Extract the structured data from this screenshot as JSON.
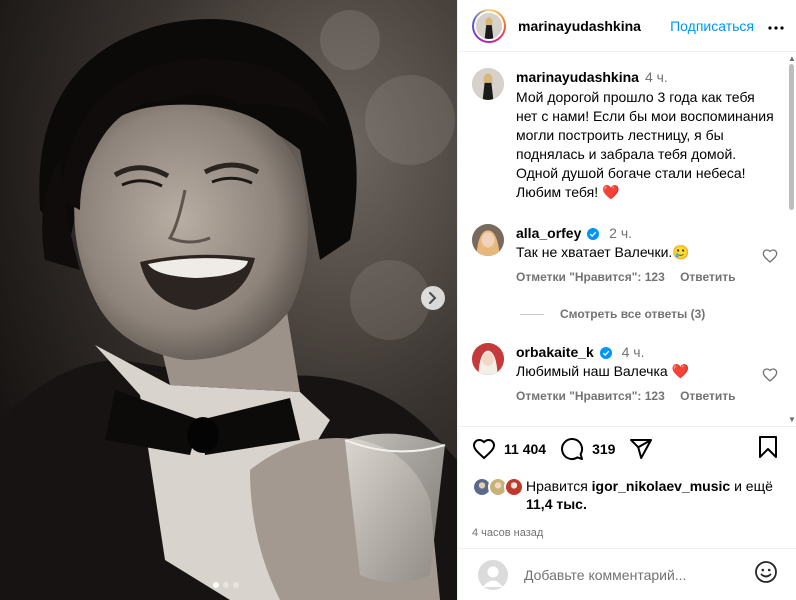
{
  "post": {
    "username": "marinayudashkina",
    "follow_label": "Подписаться",
    "more_icon": "more-horizontal-icon"
  },
  "caption": {
    "username": "marinayudashkina",
    "time": "4 ч.",
    "text": "Мой дорогой прошло 3 года как тебя нет с нами! Если бы мои воспоминания могли построить лестницу, я бы поднялась и забрала тебя домой. Одной душой богаче стали небеса! Любим тебя!",
    "emoji": "❤️"
  },
  "comments": [
    {
      "username": "alla_orfey",
      "verified": true,
      "time": "2 ч.",
      "text": "Так не хватает Валечки.",
      "emoji": "🥲",
      "likes_label": "Отметки \"Нравится\": 123",
      "reply_label": "Ответить"
    },
    {
      "username": "orbakaite_k",
      "verified": true,
      "time": "4 ч.",
      "text": "Любимый наш Валечка",
      "emoji": "❤️",
      "likes_label": "Отметки \"Нравится\": 123",
      "reply_label": "Ответить"
    }
  ],
  "view_replies_label": "Смотреть все ответы (3)",
  "stats": {
    "likes_count": "11 404",
    "comments_count": "319"
  },
  "liked_by": {
    "prefix": "Нравится",
    "user": "igor_nikolaev_music",
    "suffix": "и ещё",
    "others": "11,4 тыс."
  },
  "timestamp": "4 часов назад",
  "comment_input": {
    "placeholder": "Добавьте комментарий..."
  },
  "carousel": {
    "total": 3,
    "active_index": 0
  },
  "colors": {
    "accent": "#0095f6",
    "heart": "#d7263d",
    "muted": "#737373"
  }
}
